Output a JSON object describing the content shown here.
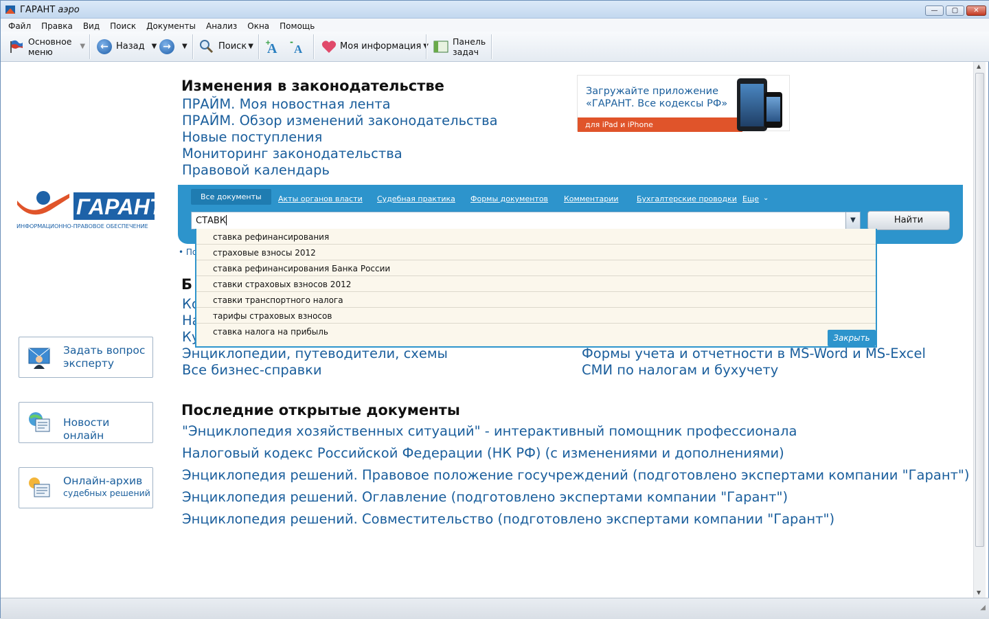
{
  "window": {
    "title": "ГАРАНТ",
    "title_suffix": "аэро"
  },
  "menu": [
    "Файл",
    "Правка",
    "Вид",
    "Поиск",
    "Документы",
    "Анализ",
    "Окна",
    "Помощь"
  ],
  "toolbar": {
    "main_menu": "Основное меню",
    "main_menu_l1": "Основное",
    "main_menu_l2": "меню",
    "back": "Назад",
    "search": "Поиск",
    "my_info": "Моя информация",
    "tasks_l1": "Панель",
    "tasks_l2": "задач"
  },
  "logo": {
    "word": "ГАРАНТ",
    "subtitle": "ИНФОРМАЦИОННО-ПРАВОВОЕ ОБЕСПЕЧЕНИЕ"
  },
  "changes": {
    "heading": "Изменения в законодательстве",
    "links": [
      "ПРАЙМ. Моя новостная лента",
      "ПРАЙМ. Обзор изменений законодательства",
      "Новые поступления",
      "Мониторинг законодательства",
      "Правовой календарь"
    ]
  },
  "ad": {
    "line1": "Загружайте приложение",
    "line2": "«ГАРАНТ. Все кодексы РФ»",
    "bar": "для iPad и iPhone"
  },
  "search": {
    "tabs": [
      "Все документы",
      "Акты органов власти",
      "Судебная практика",
      "Формы документов",
      "Комментарии",
      "Бухгалтерские проводки",
      "Еще"
    ],
    "active_tab": "Все документы",
    "query": "СТАВК",
    "find_label": "Найти",
    "close_label": "Закрыть",
    "suggestions": [
      "ставка рефинансирования",
      "страховые взносы 2012",
      "ставка рефинансирования Банка России",
      "ставки страховых взносов 2012",
      "ставки транспортного налога",
      "тарифы страховых взносов",
      "ставка налога на прибыль"
    ],
    "hidden_link_fragment": "• По"
  },
  "business": {
    "heading_fragment": "Б",
    "partial_left": [
      "Ко",
      "На",
      "Ку"
    ],
    "left": [
      "Энциклопедии, путеводители, схемы",
      "Все бизнес-справки"
    ],
    "right": [
      "Формы учета и отчетности в MS-Word и MS-Excel",
      "СМИ по налогам и бухучету"
    ]
  },
  "side": {
    "ask_l1": "Задать вопрос",
    "ask_l2": "эксперту",
    "news": "Новости онлайн",
    "archive_l1": "Онлайн-архив",
    "archive_l2": "судебных решений"
  },
  "recent": {
    "heading": "Последние открытые документы",
    "links": [
      "\"Энциклопедия хозяйственных ситуаций\" - интерактивный помощник профессионала",
      "Налоговый кодекс Российской Федерации (НК РФ) (с изменениями и дополнениями)",
      "Энциклопедия решений. Правовое положение госучреждений (подготовлено экспертами компании \"Гарант\")",
      "Энциклопедия решений. Оглавление (подготовлено экспертами компании \"Гарант\")",
      "Энциклопедия решений. Совместительство (подготовлено экспертами компании \"Гарант\")"
    ]
  },
  "colors": {
    "link": "#1a5e9c",
    "panel": "#2d94cc",
    "ad_bar": "#e0542a",
    "logo_orange": "#e0542a"
  }
}
